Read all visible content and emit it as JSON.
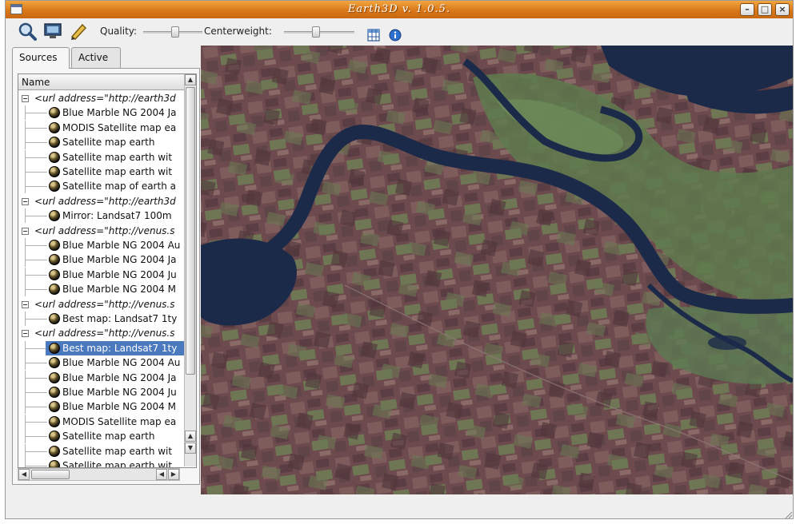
{
  "window": {
    "title": "Earth3D v. 1.0.5."
  },
  "toolbar": {
    "quality_label": "Quality:",
    "quality_level": 0.55,
    "centerweight_label": "Centerweight:",
    "centerweight_level": 0.45,
    "icons": [
      "zoom-magnifier-icon",
      "monitor-icon",
      "marker-pen-icon",
      "grid-table-icon",
      "info-icon"
    ]
  },
  "tabs": [
    {
      "label": "Sources",
      "active": true
    },
    {
      "label": "Active",
      "active": false
    }
  ],
  "tree": {
    "column_header": "Name",
    "rows": [
      {
        "text": "<url address=\"http://earth3d",
        "type": "node",
        "depth": 0
      },
      {
        "text": "Blue Marble NG 2004 Ja",
        "type": "leaf",
        "depth": 1
      },
      {
        "text": "MODIS Satellite map ea",
        "type": "leaf",
        "depth": 1
      },
      {
        "text": "Satellite map earth",
        "type": "leaf",
        "depth": 1
      },
      {
        "text": "Satellite map earth wit",
        "type": "leaf",
        "depth": 1
      },
      {
        "text": "Satellite map earth wit",
        "type": "leaf",
        "depth": 1
      },
      {
        "text": "Satellite map of earth a",
        "type": "leaf",
        "depth": 1
      },
      {
        "text": "<url address=\"http://earth3d",
        "type": "node",
        "depth": 0
      },
      {
        "text": "Mirror: Landsat7 100m",
        "type": "leaf",
        "depth": 1
      },
      {
        "text": "<url address=\"http://venus.s",
        "type": "node",
        "depth": 0
      },
      {
        "text": "Blue Marble NG 2004 Au",
        "type": "leaf",
        "depth": 1
      },
      {
        "text": "Blue Marble NG 2004 Ja",
        "type": "leaf",
        "depth": 1
      },
      {
        "text": "Blue Marble NG 2004 Ju",
        "type": "leaf",
        "depth": 1
      },
      {
        "text": "Blue Marble NG 2004 M",
        "type": "leaf",
        "depth": 1
      },
      {
        "text": "<url address=\"http://venus.s",
        "type": "node",
        "depth": 0
      },
      {
        "text": "Best map: Landsat7 1ty",
        "type": "leaf",
        "depth": 1
      },
      {
        "text": "<url address=\"http://venus.s",
        "type": "node",
        "depth": 0
      },
      {
        "text": "Best map: Landsat7 1ty",
        "type": "leaf",
        "depth": 1,
        "selected": true
      },
      {
        "text": "Blue Marble NG 2004 Au",
        "type": "leaf",
        "depth": 1
      },
      {
        "text": "Blue Marble NG 2004 Ja",
        "type": "leaf",
        "depth": 1
      },
      {
        "text": "Blue Marble NG 2004 Ju",
        "type": "leaf",
        "depth": 1
      },
      {
        "text": "Blue Marble NG 2004 M",
        "type": "leaf",
        "depth": 1
      },
      {
        "text": "MODIS Satellite map ea",
        "type": "leaf",
        "depth": 1
      },
      {
        "text": "Satellite map earth",
        "type": "leaf",
        "depth": 1
      },
      {
        "text": "Satellite map earth wit",
        "type": "leaf",
        "depth": 1
      },
      {
        "text": "Satellite map earth wit",
        "type": "leaf",
        "depth": 1
      }
    ]
  },
  "map": {
    "view": "satellite-river-landscape",
    "colors": {
      "land": "#6c4a4e",
      "field_light": "#7e5c5c",
      "field_green": "#5f7a4e",
      "water": "#1c2a4a"
    }
  }
}
